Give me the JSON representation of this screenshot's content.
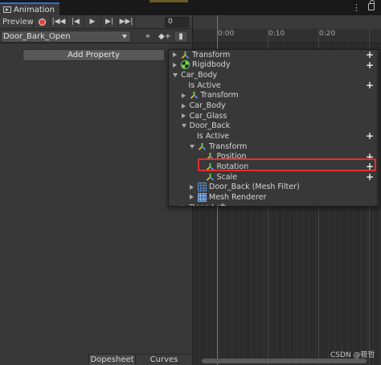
{
  "window": {
    "tab_title": "Animation"
  },
  "toolbar": {
    "preview_label": "Preview",
    "frame_value": "0"
  },
  "clip": {
    "selected": "Door_Bark_Open"
  },
  "add_property_label": "Add Property",
  "timeline": {
    "ruler_labels": [
      "0:00",
      "0:10",
      "0:20"
    ],
    "playhead_color": "#4d7ad8"
  },
  "property_list": [
    {
      "label": "Transform",
      "indent": 0,
      "expander": "right",
      "icon": "transform-icon",
      "plus": true
    },
    {
      "label": "Rigidbody",
      "indent": 0,
      "expander": "right",
      "icon": "rigidbody-icon",
      "plus": true
    },
    {
      "label": "Car_Body",
      "indent": 0,
      "expander": "down",
      "icon": "",
      "plus": false
    },
    {
      "label": "Is Active",
      "indent": 1,
      "expander": "",
      "icon": "",
      "plus": true
    },
    {
      "label": "Transform",
      "indent": 1,
      "expander": "right",
      "icon": "transform-icon",
      "plus": false
    },
    {
      "label": "Car_Body",
      "indent": 1,
      "expander": "right",
      "icon": "",
      "plus": false
    },
    {
      "label": "Car_Glass",
      "indent": 1,
      "expander": "right",
      "icon": "",
      "plus": false
    },
    {
      "label": "Door_Back",
      "indent": 1,
      "expander": "down",
      "icon": "",
      "plus": false
    },
    {
      "label": "Is Active",
      "indent": 2,
      "expander": "",
      "icon": "",
      "plus": true
    },
    {
      "label": "Transform",
      "indent": 2,
      "expander": "down",
      "icon": "transform-icon",
      "plus": false
    },
    {
      "label": "Position",
      "indent": 3,
      "expander": "",
      "icon": "transform-icon",
      "plus": true
    },
    {
      "label": "Rotation",
      "indent": 3,
      "expander": "",
      "icon": "transform-icon",
      "plus": true
    },
    {
      "label": "Scale",
      "indent": 3,
      "expander": "",
      "icon": "transform-icon",
      "plus": true
    },
    {
      "label": "Door_Back (Mesh Filter)",
      "indent": 2,
      "expander": "right",
      "icon": "mesh-filter-icon",
      "plus": false
    },
    {
      "label": "Mesh Renderer",
      "indent": 2,
      "expander": "right",
      "icon": "mesh-renderer-icon",
      "plus": false
    },
    {
      "label": "Door_Left",
      "indent": 1,
      "expander": "right",
      "icon": "",
      "plus": false
    }
  ],
  "highlighted_item": "Rotation",
  "bottom_tabs": {
    "dopesheet": "Dopesheet",
    "curves": "Curves"
  },
  "watermark": "CSDN @筱哲",
  "colors": {
    "record": "#e04545",
    "highlight_border": "#e03030",
    "tab_accent": "#2e6fd6"
  }
}
